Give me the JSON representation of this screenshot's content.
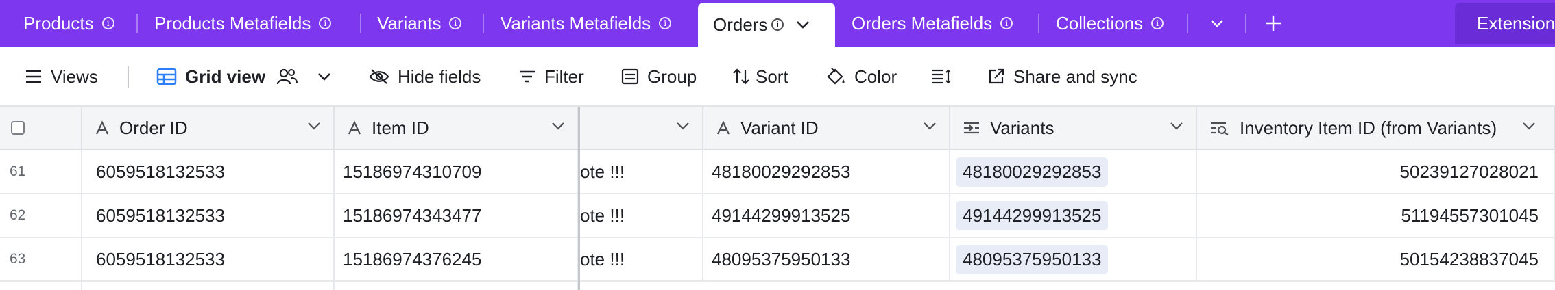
{
  "tabs": [
    {
      "label": "Products"
    },
    {
      "label": "Products Metafields"
    },
    {
      "label": "Variants"
    },
    {
      "label": "Variants Metafields"
    },
    {
      "label": "Orders"
    },
    {
      "label": "Orders Metafields"
    },
    {
      "label": "Collections"
    }
  ],
  "extensions_label": "Extension",
  "toolbar": {
    "views": "Views",
    "grid_view": "Grid view",
    "hide_fields": "Hide fields",
    "filter": "Filter",
    "group": "Group",
    "sort": "Sort",
    "color": "Color",
    "share": "Share and sync"
  },
  "columns": [
    {
      "label": "Order ID"
    },
    {
      "label": "Item ID"
    },
    {
      "label": ""
    },
    {
      "label": "Variant ID"
    },
    {
      "label": "Variants"
    },
    {
      "label": "Inventory Item ID (from Variants)"
    }
  ],
  "rows": [
    {
      "num": "61",
      "order_id": "6059518132533",
      "item_id": "15186974310709",
      "note": "ote !!!",
      "variant_id": "48180029292853",
      "variants": "48180029292853",
      "inventory_item_id": "50239127028021"
    },
    {
      "num": "62",
      "order_id": "6059518132533",
      "item_id": "15186974343477",
      "note": "ote !!!",
      "variant_id": "49144299913525",
      "variants": "49144299913525",
      "inventory_item_id": "51194557301045"
    },
    {
      "num": "63",
      "order_id": "6059518132533",
      "item_id": "15186974376245",
      "note": "ote !!!",
      "variant_id": "48095375950133",
      "variants": "48095375950133",
      "inventory_item_id": "50154238837045"
    }
  ],
  "colors": {
    "tabbar": "#7c37ef",
    "chip": "#e7ecf7"
  }
}
